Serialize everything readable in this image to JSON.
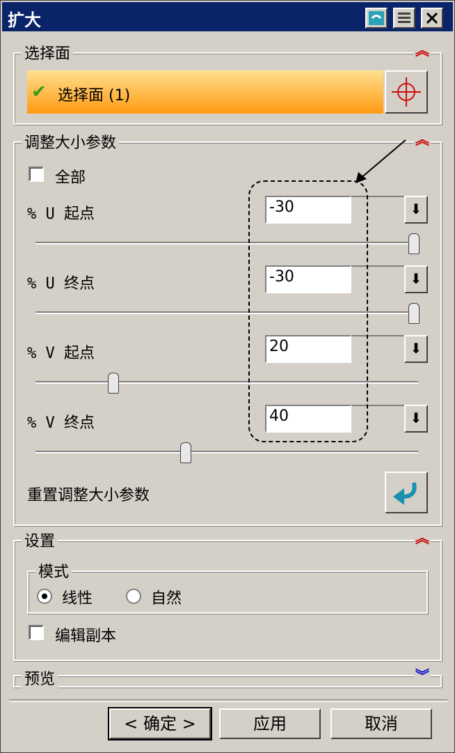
{
  "window": {
    "title": "扩大"
  },
  "select_face": {
    "group_label": "选择面",
    "selection_label": "选择面 (1)"
  },
  "resize": {
    "group_label": "调整大小参数",
    "all_label": "全部",
    "all_checked": false,
    "params": [
      {
        "label": "% U 起点",
        "value": "-30",
        "slider_fraction": 1.0
      },
      {
        "label": "% U 终点",
        "value": "-30",
        "slider_fraction": 1.0
      },
      {
        "label": "% V 起点",
        "value": "20",
        "slider_fraction": 0.2
      },
      {
        "label": "% V 终点",
        "value": "40",
        "slider_fraction": 0.4
      }
    ],
    "reset_label": "重置调整大小参数"
  },
  "settings": {
    "group_label": "设置",
    "mode_label": "模式",
    "mode_linear": "线性",
    "mode_natural": "自然",
    "selected_mode": "线性",
    "edit_copy_label": "编辑副本",
    "edit_copy_checked": false
  },
  "preview": {
    "group_label": "预览"
  },
  "buttons": {
    "ok": "< 确定 >",
    "apply": "应用",
    "cancel": "取消"
  },
  "icons": {
    "check": "check-icon",
    "crosshair": "crosshair-icon",
    "reset": "reset-arrow-icon",
    "dropdown": "dropdown-arrow-icon",
    "collapse": "collapse-chevron-icon",
    "expand": "expand-chevron-icon"
  },
  "colors": {
    "title_bg": "#0a246a",
    "selection_bar": "#ff9a10",
    "collapse": "#cc0000",
    "expand": "#1010cc"
  }
}
